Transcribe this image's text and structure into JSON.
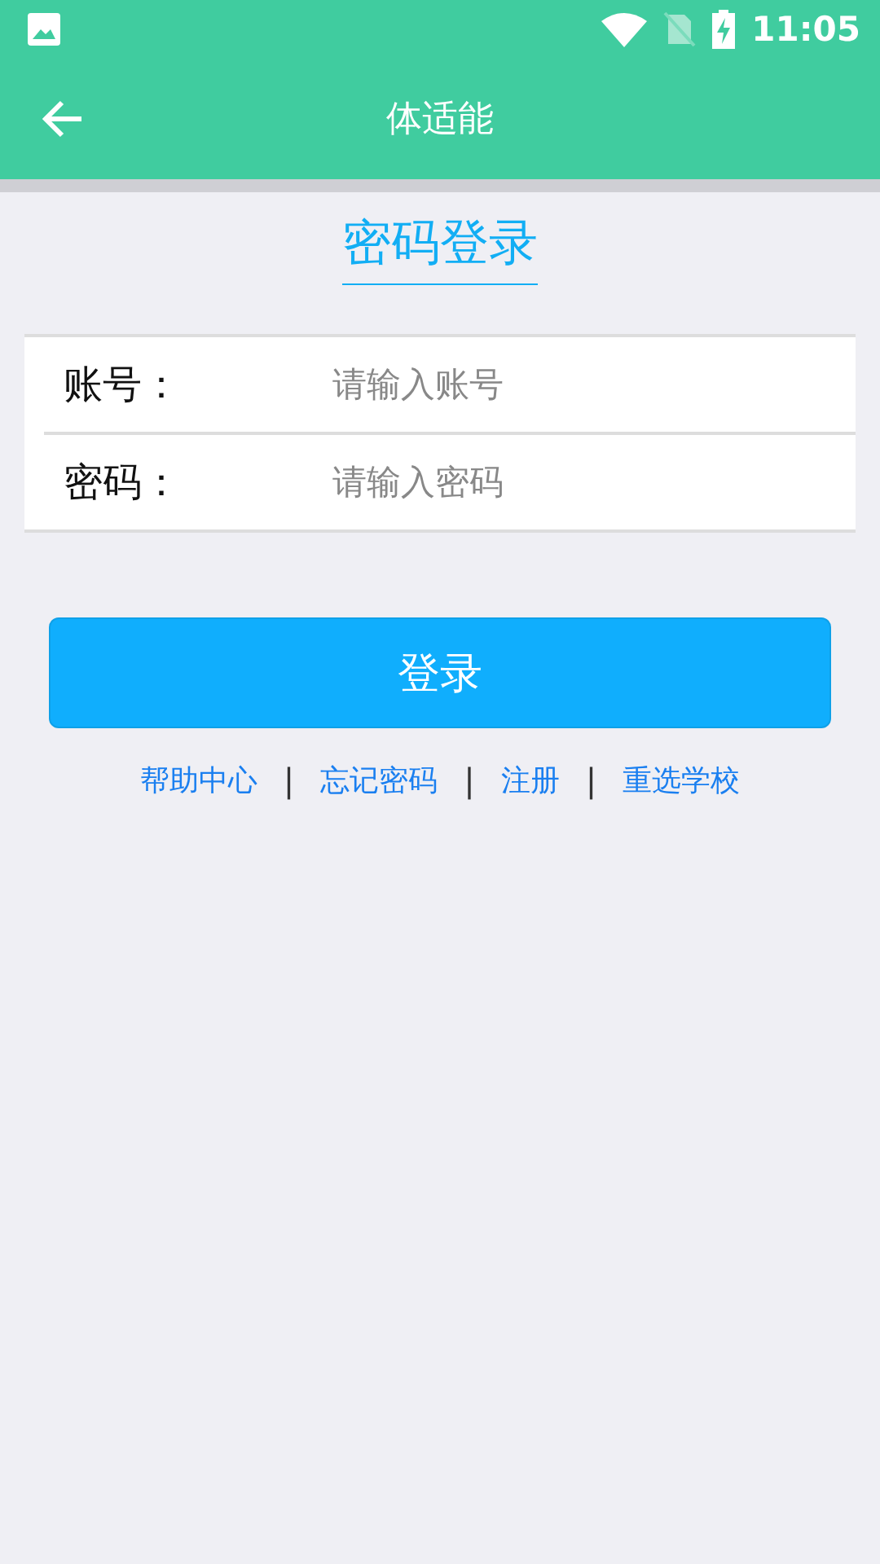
{
  "status_bar": {
    "time": "11:05"
  },
  "app_bar": {
    "title": "体适能"
  },
  "heading": "密码登录",
  "fields": [
    {
      "label": "账号：",
      "placeholder": "请输入账号"
    },
    {
      "label": "密码：",
      "placeholder": "请输入密码"
    }
  ],
  "login_button": "登录",
  "links": [
    {
      "label": "帮助中心",
      "separator": "|"
    },
    {
      "label": "忘记密码",
      "separator": "|"
    },
    {
      "label": "注册",
      "separator": "|"
    },
    {
      "label": "重选学校"
    }
  ]
}
